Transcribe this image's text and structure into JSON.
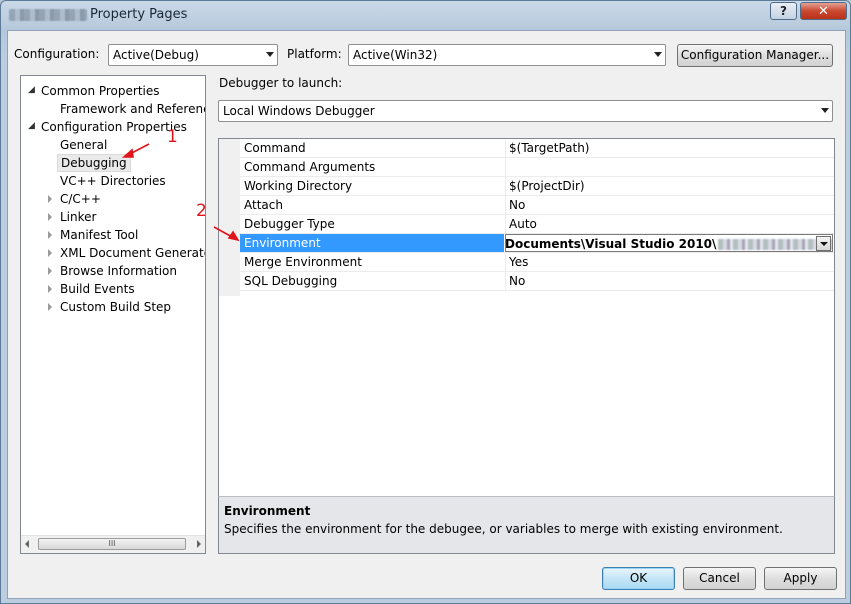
{
  "window": {
    "title": "Property Pages",
    "help_glyph": "?",
    "close_glyph": "✕"
  },
  "header": {
    "configuration_label": "Configuration:",
    "configuration_value": "Active(Debug)",
    "platform_label": "Platform:",
    "platform_value": "Active(Win32)",
    "config_manager_label": "Configuration Manager..."
  },
  "tree": {
    "items": [
      {
        "label": "Common Properties",
        "expander": "open"
      },
      {
        "label": "Framework and References",
        "expander": "none"
      },
      {
        "label": "Configuration Properties",
        "expander": "open"
      },
      {
        "label": "General",
        "expander": "none"
      },
      {
        "label": "Debugging",
        "expander": "none",
        "selected": true
      },
      {
        "label": "VC++ Directories",
        "expander": "none"
      },
      {
        "label": "C/C++",
        "expander": "closed"
      },
      {
        "label": "Linker",
        "expander": "closed"
      },
      {
        "label": "Manifest Tool",
        "expander": "closed"
      },
      {
        "label": "XML Document Generator",
        "expander": "closed"
      },
      {
        "label": "Browse Information",
        "expander": "closed"
      },
      {
        "label": "Build Events",
        "expander": "closed"
      },
      {
        "label": "Custom Build Step",
        "expander": "closed"
      }
    ],
    "scroll_grip": "III"
  },
  "debugger": {
    "launch_label": "Debugger to launch:",
    "launch_value": "Local Windows Debugger"
  },
  "properties": {
    "rows": [
      {
        "name": "Command",
        "value": "$(TargetPath)"
      },
      {
        "name": "Command Arguments",
        "value": ""
      },
      {
        "name": "Working Directory",
        "value": "$(ProjectDir)"
      },
      {
        "name": "Attach",
        "value": "No"
      },
      {
        "name": "Debugger Type",
        "value": "Auto"
      },
      {
        "name": "Environment",
        "value": "Documents\\Visual Studio 2010\\",
        "selected": true
      },
      {
        "name": "Merge Environment",
        "value": "Yes"
      },
      {
        "name": "SQL Debugging",
        "value": "No"
      }
    ]
  },
  "description": {
    "title": "Environment",
    "text": "Specifies the environment for the debugee, or variables to merge with existing environment."
  },
  "buttons": {
    "ok": "OK",
    "cancel": "Cancel",
    "apply": "Apply"
  },
  "annotations": {
    "one": "1",
    "two": "2",
    "color": "#e0141b"
  },
  "colors": {
    "selection": "#3399ff",
    "close_button": "#c9482f"
  }
}
